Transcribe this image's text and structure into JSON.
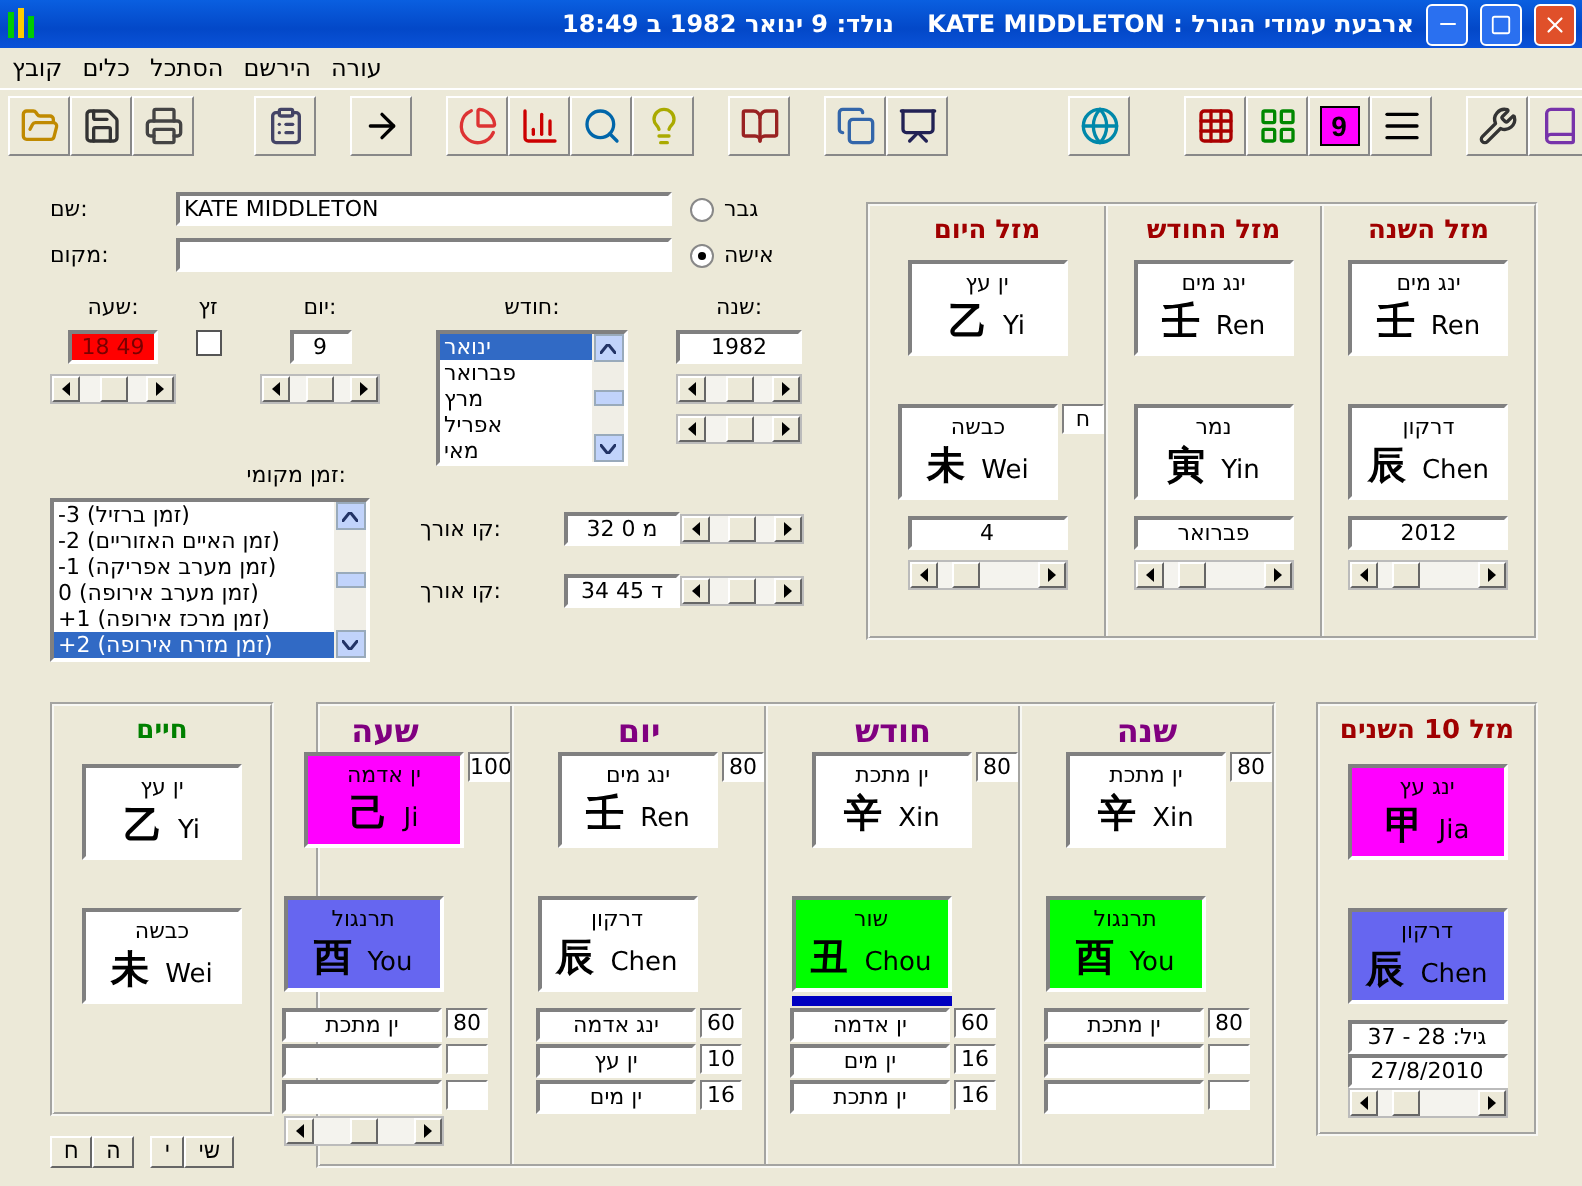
{
  "window": {
    "title": "ארבעת עמודי הגורל : KATE MIDDLETON    נולד: 9 ינואר 1982 ב 18:49"
  },
  "menu": [
    "עורה",
    "הירשם",
    "הסתכל",
    "כלים",
    "קובץ"
  ],
  "toolbar": {
    "number_button": "9"
  },
  "form": {
    "name": {
      "label": "שם:",
      "value": "KATE MIDDLETON"
    },
    "place": {
      "label": "מקום:"
    },
    "gender": [
      {
        "label": "גבר",
        "selected": false
      },
      {
        "label": "אישה",
        "selected": true
      }
    ],
    "hour": {
      "label": "שעה:",
      "value": "18 49",
      "highlighted": true
    },
    "dst": {
      "label": "זץ",
      "checked": false
    },
    "day": {
      "label": "יום:",
      "value": "9"
    },
    "month": {
      "label": "חודש:",
      "options": [
        {
          "label": "ינואר",
          "selected": true
        },
        {
          "label": "פברואר",
          "selected": false
        },
        {
          "label": "מרץ",
          "selected": false
        },
        {
          "label": "אפריל",
          "selected": false
        },
        {
          "label": "מאי",
          "selected": false
        }
      ]
    },
    "year": {
      "label": "שנה:",
      "value": "1982"
    },
    "timezone": {
      "label": "זמן מקומי:",
      "options": [
        {
          "label": "-3 (זמן ברזיל)",
          "selected": false
        },
        {
          "label": "-2 (זמן האיים האזוריים)",
          "selected": false
        },
        {
          "label": "-1 (זמן מערב אפריקה)",
          "selected": false
        },
        {
          "label": "0 (זמן מערב אירופה)",
          "selected": false
        },
        {
          "label": "+1 (זמן מרכז אירופה)",
          "selected": false
        },
        {
          "label": "+2 (זמן מזרח אירופה)",
          "selected": true
        }
      ]
    },
    "coordinates": [
      {
        "label": "קו אורך:",
        "value": "32 0 מ"
      },
      {
        "label": "קו אורך:",
        "value": "34 45 ד"
      }
    ]
  },
  "top_pillars": [
    {
      "title": "מזל השנה",
      "stem": {
        "hebrew": "ינג מים",
        "hanzi": "壬",
        "pinyin": "Ren",
        "color": "#ffffff"
      },
      "branch": {
        "hebrew": "דרקון",
        "hanzi": "辰",
        "pinyin": "Chen",
        "color": "#ffffff"
      },
      "value": "2012"
    },
    {
      "title": "מזל החודש",
      "stem": {
        "hebrew": "ינג מים",
        "hanzi": "壬",
        "pinyin": "Ren",
        "color": "#ffffff"
      },
      "branch": {
        "hebrew": "נמר",
        "hanzi": "寅",
        "pinyin": "Yin",
        "color": "#ffffff"
      },
      "value": "פברואר"
    },
    {
      "title": "מזל היום",
      "stem": {
        "hebrew": "ין עץ",
        "hanzi": "乙",
        "pinyin": "Yi",
        "color": "#ffffff"
      },
      "branch": {
        "hebrew": "כבשה",
        "hanzi": "未",
        "pinyin": "Wei",
        "color": "#ffffff"
      },
      "marker": "ח",
      "value": "4"
    }
  ],
  "life": {
    "title": "חיים",
    "stem": {
      "hebrew": "ין עץ",
      "hanzi": "乙",
      "pinyin": "Yi",
      "color": "#ffffff"
    },
    "branch": {
      "hebrew": "כבשה",
      "hanzi": "未",
      "pinyin": "Wei",
      "color": "#ffffff"
    },
    "buttons": [
      "שי",
      "י",
      "ה",
      "ח"
    ]
  },
  "pillars": [
    {
      "title": "שנה",
      "stem": {
        "hebrew": "ין מתכת",
        "hanzi": "辛",
        "pinyin": "Xin",
        "color": "#ffffff",
        "score": "80"
      },
      "branch": {
        "hebrew": "תרנגול",
        "hanzi": "酉",
        "pinyin": "You",
        "color": "#00ff00"
      },
      "underlined": false,
      "scroller": false,
      "elements": [
        {
          "name": "ין מתכת",
          "value": "80"
        }
      ]
    },
    {
      "title": "חודש",
      "stem": {
        "hebrew": "ין מתכת",
        "hanzi": "辛",
        "pinyin": "Xin",
        "color": "#ffffff",
        "score": "80"
      },
      "branch": {
        "hebrew": "שור",
        "hanzi": "丑",
        "pinyin": "Chou",
        "color": "#00ff00"
      },
      "underlined": true,
      "scroller": false,
      "elements": [
        {
          "name": "ין אדמה",
          "value": "60"
        },
        {
          "name": "ין מים",
          "value": "16"
        },
        {
          "name": "ין מתכת",
          "value": "16"
        }
      ]
    },
    {
      "title": "יום",
      "stem": {
        "hebrew": "ינג מים",
        "hanzi": "壬",
        "pinyin": "Ren",
        "color": "#ffffff",
        "score": "80"
      },
      "branch": {
        "hebrew": "דרקון",
        "hanzi": "辰",
        "pinyin": "Chen",
        "color": "#ffffff"
      },
      "underlined": false,
      "scroller": false,
      "elements": [
        {
          "name": "ינג אדמה",
          "value": "60"
        },
        {
          "name": "ין עץ",
          "value": "10"
        },
        {
          "name": "ין מים",
          "value": "16"
        }
      ]
    },
    {
      "title": "שעה",
      "stem": {
        "hebrew": "ין אדמה",
        "hanzi": "己",
        "pinyin": "Ji",
        "color": "#ff00ff",
        "score": "100"
      },
      "branch": {
        "hebrew": "תרנגול",
        "hanzi": "酉",
        "pinyin": "You",
        "color": "#6666f0"
      },
      "underlined": false,
      "scroller": true,
      "elements": [
        {
          "name": "ין מתכת",
          "value": "80"
        }
      ]
    }
  ],
  "luck": {
    "title": "מזל 10 השנים",
    "stem": {
      "hebrew": "ינג עץ",
      "hanzi": "甲",
      "pinyin": "Jia",
      "color": "#ff00ff"
    },
    "branch": {
      "hebrew": "דרקון",
      "hanzi": "辰",
      "pinyin": "Chen",
      "color": "#6666f0"
    },
    "age": "גיל: 28 - 37",
    "date": "27/8/2010"
  }
}
